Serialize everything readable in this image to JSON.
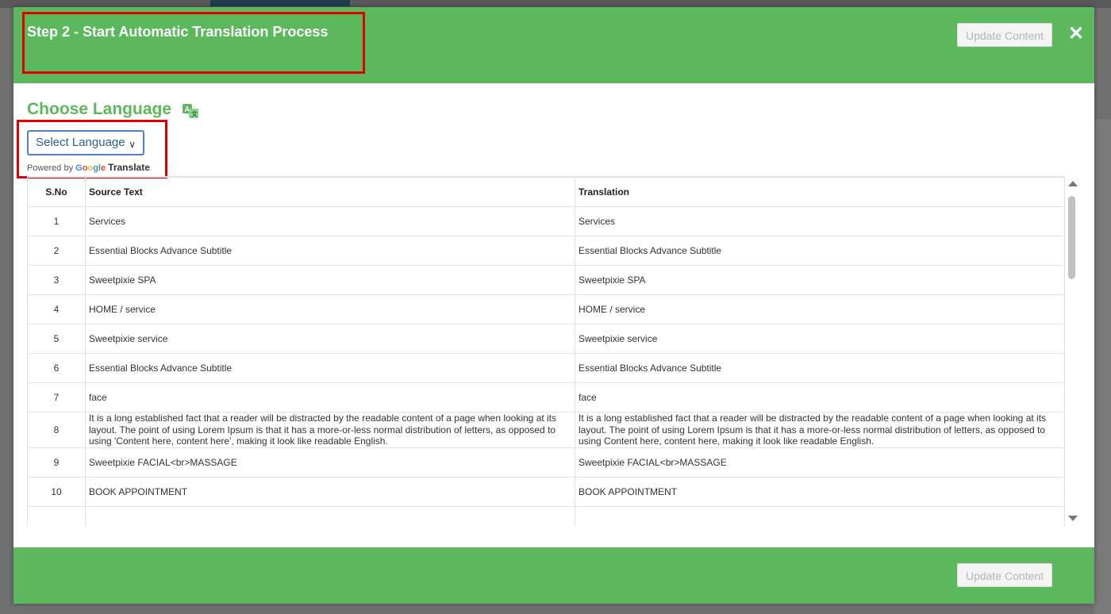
{
  "modal": {
    "title": "Step 2 - Start Automatic Translation Process",
    "update_label": "Update Content",
    "close_symbol": "✕",
    "choose_title": "Choose Language",
    "select_label": "Select Language",
    "powered_prefix": "Powered by",
    "powered_brand": "Google",
    "powered_suffix": "Translate",
    "footer_update_label": "Update Content"
  },
  "table": {
    "headers": {
      "sno": "S.No",
      "source": "Source Text",
      "translation": "Translation"
    },
    "rows": [
      {
        "sno": "1",
        "source": "Services",
        "translation": "Services"
      },
      {
        "sno": "2",
        "source": "Essential Blocks Advance Subtitle",
        "translation": "Essential Blocks Advance Subtitle"
      },
      {
        "sno": "3",
        "source": "Sweetpixie SPA",
        "translation": "Sweetpixie SPA"
      },
      {
        "sno": "4",
        "source": "HOME / service",
        "translation": "HOME / service"
      },
      {
        "sno": "5",
        "source": "Sweetpixie service",
        "translation": "Sweetpixie service"
      },
      {
        "sno": "6",
        "source": "Essential Blocks Advance Subtitle",
        "translation": "Essential Blocks Advance Subtitle"
      },
      {
        "sno": "7",
        "source": "face",
        "translation": "face"
      },
      {
        "sno": "8",
        "source": "It is a long established fact that a reader will be distracted by the readable content of a page when looking at its layout. The point of using Lorem Ipsum is that it has a more-or-less normal distribution of letters, as opposed to using 'Content here, content here', making it look like readable English.",
        "translation": "It is a long established fact that a reader will be distracted by the readable content of a page when looking at its layout. The point of using Lorem Ipsum is that it has a more-or-less normal distribution of letters, as opposed to using Content here, content here, making it look like readable English."
      },
      {
        "sno": "9",
        "source": "Sweetpixie FACIAL<br>MASSAGE",
        "translation": "Sweetpixie FACIAL<br>MASSAGE"
      },
      {
        "sno": "10",
        "source": "BOOK APPOINTMENT",
        "translation": "BOOK APPOINTMENT"
      }
    ]
  },
  "colors": {
    "header_green": "#5cb85c",
    "highlight_red": "#e00000",
    "select_blue": "#4a86c7"
  },
  "icons": [
    "close-icon",
    "translate-icon",
    "chevron-down-icon",
    "scroll-up-arrow-icon",
    "scroll-down-arrow-icon"
  ]
}
